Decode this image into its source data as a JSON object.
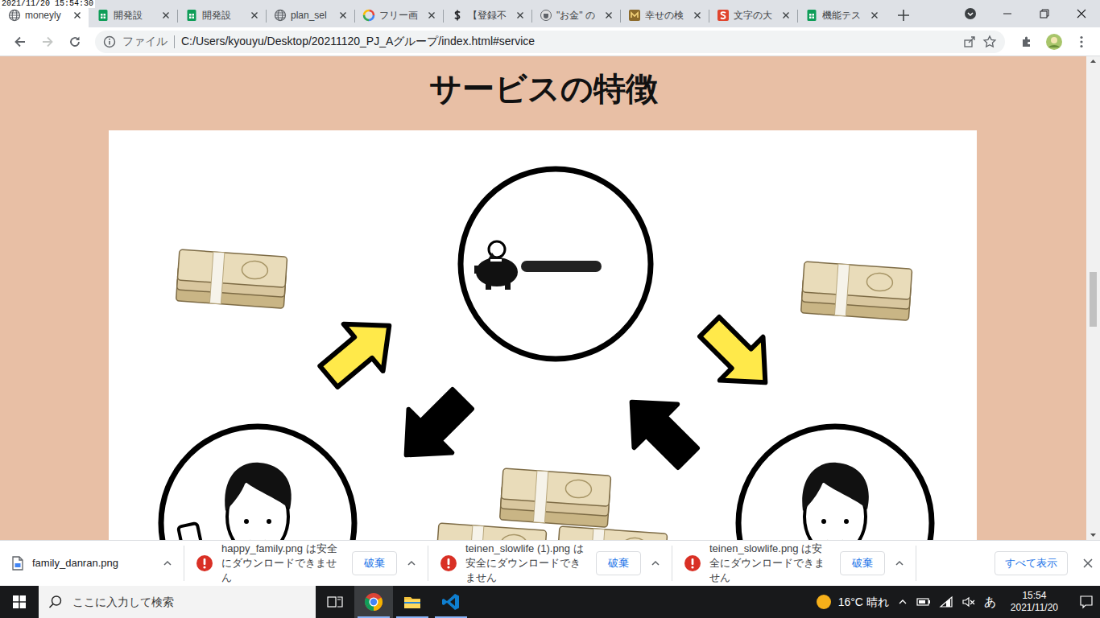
{
  "overlay": {
    "timestamp": "2021/11/20 15:54:30"
  },
  "tabs": [
    {
      "label": "moneyly",
      "kind": "globe",
      "selected": true
    },
    {
      "label": "開発設",
      "kind": "sheets",
      "selected": false
    },
    {
      "label": "開発設",
      "kind": "sheets",
      "selected": false
    },
    {
      "label": "plan_sel",
      "kind": "globe",
      "selected": false
    },
    {
      "label": "フリー画",
      "kind": "google",
      "selected": false
    },
    {
      "label": "【登録不",
      "kind": "dollar",
      "selected": false
    },
    {
      "label": "\"お金\" の",
      "kind": "cup",
      "selected": false
    },
    {
      "label": "幸せの検",
      "kind": "brand",
      "selected": false
    },
    {
      "label": "文字の大",
      "kind": "slide",
      "selected": false
    },
    {
      "label": "機能テス",
      "kind": "sheets",
      "selected": false
    }
  ],
  "address_bar": {
    "scheme": "ファイル",
    "url": "C:/Users/kyouyu/Desktop/20211120_PJ_Aグループ/index.html#service"
  },
  "page": {
    "heading": "サービスの特徴"
  },
  "downloads": {
    "items": [
      {
        "kind": "file",
        "filename": "family_danran.png"
      },
      {
        "kind": "blocked",
        "message": "happy_family.png は安全にダウンロードできません",
        "action": "破棄"
      },
      {
        "kind": "blocked",
        "message": "teinen_slowlife (1).png は安全にダウンロードできません",
        "action": "破棄"
      },
      {
        "kind": "blocked",
        "message": "teinen_slowlife.png は安全にダウンロードできません",
        "action": "破棄"
      }
    ],
    "show_all": "すべて表示"
  },
  "taskbar": {
    "search_placeholder": "ここに入力して検索",
    "apps": [
      {
        "kind": "chrome",
        "selected": true
      },
      {
        "kind": "explorer",
        "selected": false
      },
      {
        "kind": "vscode",
        "selected": false
      }
    ],
    "weather": "16°C 晴れ",
    "ime": "あ",
    "time": "15:54",
    "date": "2021/11/20"
  }
}
